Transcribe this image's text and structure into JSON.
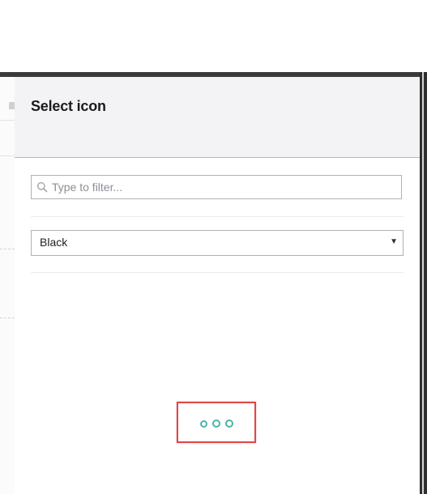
{
  "dialog": {
    "title": "Select icon"
  },
  "search": {
    "placeholder": "Type to filter...",
    "value": ""
  },
  "color_select": {
    "selected": "Black"
  },
  "loader": {
    "state": "loading",
    "dots": 3
  },
  "colors": {
    "accent": "#4fb3a3",
    "highlight_border": "#e04646",
    "header_bg": "#f3f3f5",
    "frame": "#2f2f2f"
  },
  "icons": {
    "search": "search-icon",
    "dropdown": "chevron-down-icon"
  }
}
